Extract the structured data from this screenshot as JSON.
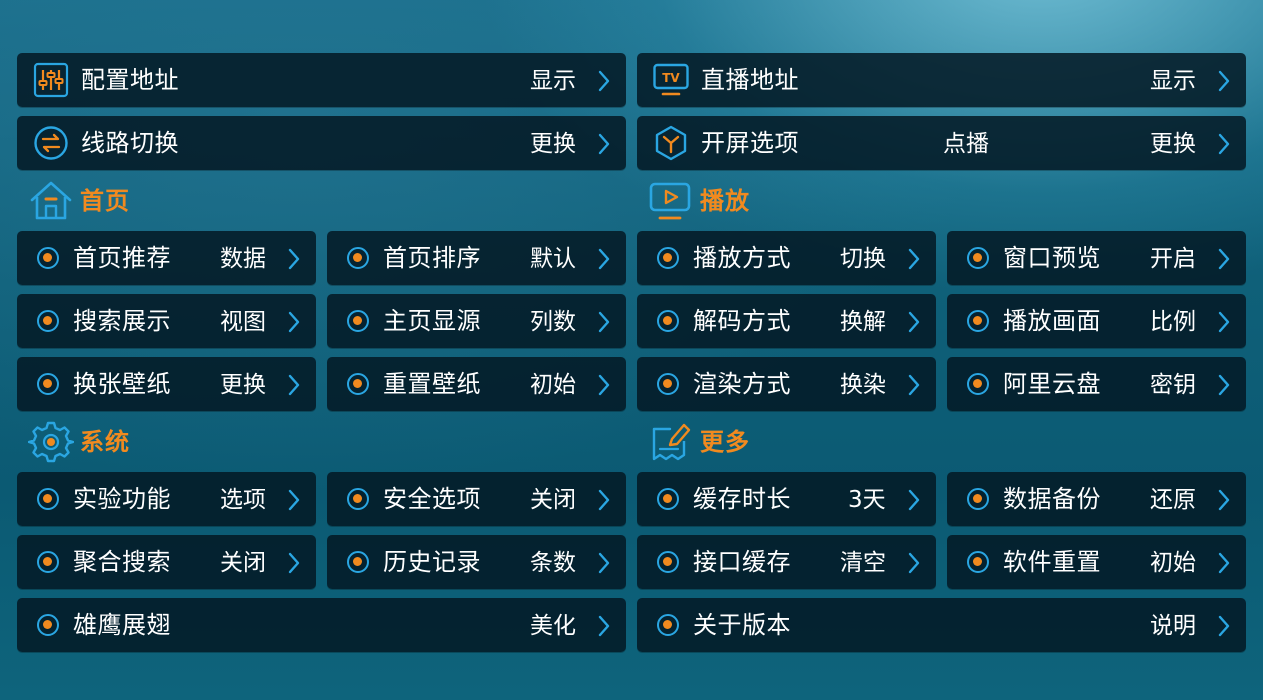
{
  "top": [
    {
      "label": "配置地址",
      "value": "显示",
      "icon": "sliders-icon"
    },
    {
      "label": "直播地址",
      "value": "显示",
      "icon": "tv-icon"
    },
    {
      "label": "线路切换",
      "value": "更换",
      "icon": "swap-icon"
    },
    {
      "label": "开屏选项",
      "middle": "点播",
      "value": "更换",
      "icon": "hex-y-icon"
    }
  ],
  "sections": {
    "home": {
      "title": "首页",
      "icon": "home-icon"
    },
    "play": {
      "title": "播放",
      "icon": "play-icon"
    },
    "system": {
      "title": "系统",
      "icon": "gear-icon"
    },
    "more": {
      "title": "更多",
      "icon": "edit-note-icon"
    }
  },
  "home_items": [
    {
      "label": "首页推荐",
      "value": "数据"
    },
    {
      "label": "首页排序",
      "value": "默认"
    },
    {
      "label": "搜索展示",
      "value": "视图"
    },
    {
      "label": "主页显源",
      "value": "列数"
    },
    {
      "label": "换张壁纸",
      "value": "更换"
    },
    {
      "label": "重置壁纸",
      "value": "初始"
    }
  ],
  "play_items": [
    {
      "label": "播放方式",
      "value": "切换"
    },
    {
      "label": "窗口预览",
      "value": "开启"
    },
    {
      "label": "解码方式",
      "value": "换解"
    },
    {
      "label": "播放画面",
      "value": "比例"
    },
    {
      "label": "渲染方式",
      "value": "换染"
    },
    {
      "label": "阿里云盘",
      "value": "密钥"
    }
  ],
  "system_items": [
    {
      "label": "实验功能",
      "value": "选项"
    },
    {
      "label": "安全选项",
      "value": "关闭"
    },
    {
      "label": "聚合搜索",
      "value": "关闭"
    },
    {
      "label": "历史记录",
      "value": "条数"
    },
    {
      "label": "雄鹰展翅",
      "value": "美化"
    }
  ],
  "more_items": [
    {
      "label": "缓存时长",
      "value": "3天"
    },
    {
      "label": "数据备份",
      "value": "还原"
    },
    {
      "label": "接口缓存",
      "value": "清空"
    },
    {
      "label": "软件重置",
      "value": "初始"
    },
    {
      "label": "关于版本",
      "value": "说明"
    }
  ],
  "colors": {
    "accent_orange": "#f18a1f",
    "accent_blue": "#2aa6e2",
    "row_bg": "#031824"
  }
}
